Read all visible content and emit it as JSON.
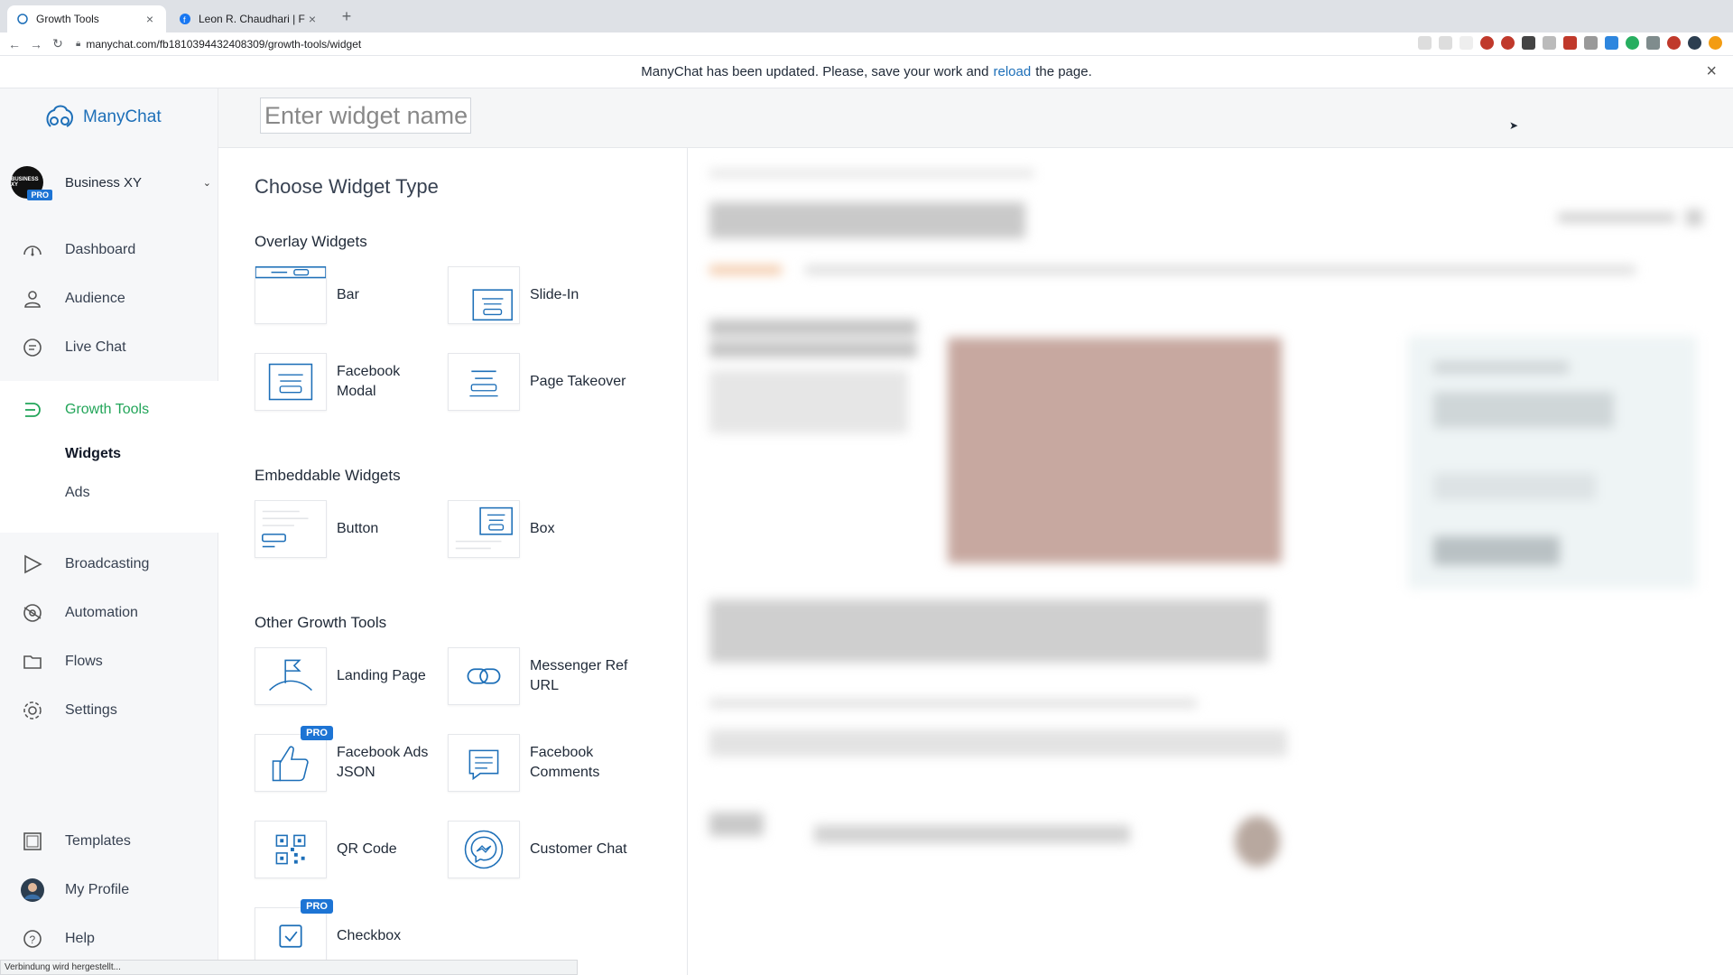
{
  "browser": {
    "tabs": [
      {
        "label": "Growth Tools",
        "active": true
      },
      {
        "label": "Leon R. Chaudhari | Facebook",
        "active": false
      }
    ],
    "url": "manychat.com/fb181039443240830​9/growth-tools/widget"
  },
  "banner": {
    "text_before": "ManyChat has been updated. Please, save your work and",
    "link": "reload",
    "text_after": "the page."
  },
  "sidebar": {
    "logo": "ManyChat",
    "workspace": {
      "name": "Business XY",
      "avatar_text": "BUSINESS XY",
      "badge": "PRO"
    },
    "items": [
      {
        "label": "Dashboard",
        "icon": "dashboard-icon"
      },
      {
        "label": "Audience",
        "icon": "user-icon"
      },
      {
        "label": "Live Chat",
        "icon": "chat-bubble-icon"
      },
      {
        "label": "Growth Tools",
        "icon": "growth-tools-icon"
      },
      {
        "label": "Broadcasting",
        "icon": "send-icon"
      },
      {
        "label": "Automation",
        "icon": "automation-icon"
      },
      {
        "label": "Flows",
        "icon": "folder-icon"
      },
      {
        "label": "Settings",
        "icon": "gear-icon"
      },
      {
        "label": "Templates",
        "icon": "templates-icon"
      },
      {
        "label": "My Profile",
        "icon": "avatar-icon"
      },
      {
        "label": "Help",
        "icon": "help-icon"
      }
    ],
    "sub_items": [
      {
        "label": "Widgets"
      },
      {
        "label": "Ads"
      }
    ]
  },
  "header": {
    "placeholder": "Enter widget name"
  },
  "chooser": {
    "title": "Choose Widget Type",
    "sections": [
      {
        "title": "Overlay Widgets"
      },
      {
        "title": "Embeddable Widgets"
      },
      {
        "title": "Other Growth Tools"
      }
    ],
    "widgets": [
      {
        "label": "Bar",
        "icon": "bar-widget-icon"
      },
      {
        "label": "Slide-In",
        "icon": "slide-in-icon"
      },
      {
        "label": "Facebook\nModal",
        "icon": "modal-icon"
      },
      {
        "label": "Page Takeover",
        "icon": "page-takeover-icon"
      },
      {
        "label": "Button",
        "icon": "button-widget-icon"
      },
      {
        "label": "Box",
        "icon": "box-widget-icon"
      },
      {
        "label": "Landing Page",
        "icon": "landing-page-icon"
      },
      {
        "label": "Messenger Ref\nURL",
        "icon": "link-icon"
      },
      {
        "label": "Facebook Ads\nJSON",
        "icon": "thumbs-up-icon",
        "badge": "PRO"
      },
      {
        "label": "Facebook\nComments",
        "icon": "comment-icon"
      },
      {
        "label": "QR Code",
        "icon": "qr-code-icon"
      },
      {
        "label": "Customer Chat",
        "icon": "messenger-icon"
      },
      {
        "label": "Checkbox",
        "icon": "checkbox-icon",
        "badge": "PRO"
      }
    ]
  },
  "statusbar": {
    "text": "Verbindung wird hergestellt..."
  },
  "colors": {
    "brand_blue": "#1d6fb8",
    "active_green": "#22a559",
    "pro_blue": "#1d74d4"
  }
}
